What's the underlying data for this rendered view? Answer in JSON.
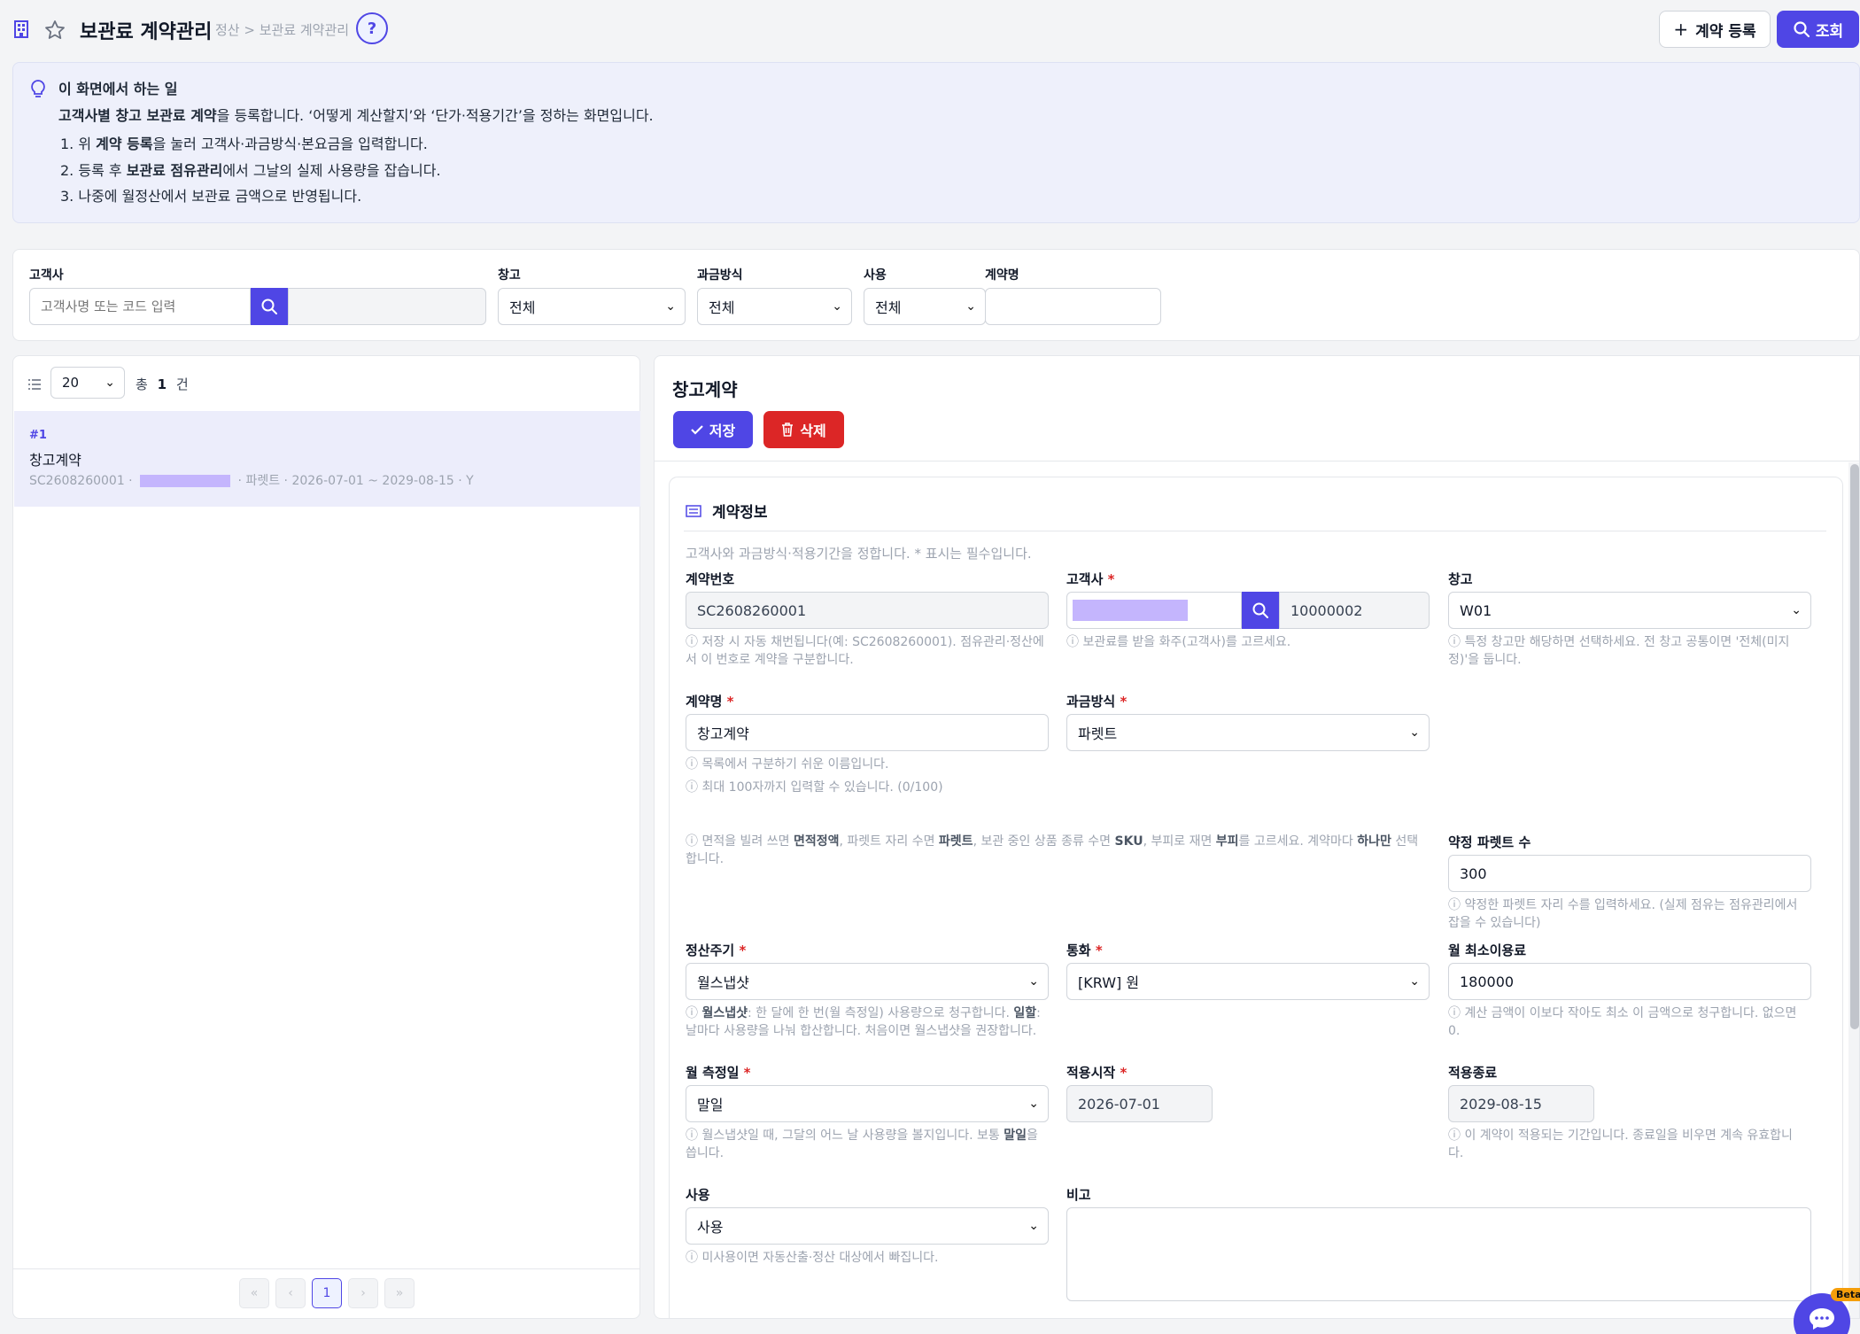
{
  "header": {
    "title": "보관료 계약관리",
    "breadcrumb": "정산 > 보관료 계약관리",
    "help_label": "?",
    "register_label": "계약 등록",
    "search_label": "조회"
  },
  "info": {
    "heading": "이 화면에서 하는 일",
    "intro_bold": "고객사별 창고 보관료 계약",
    "intro_rest": "을 등록합니다. ‘어떻게 계산할지’와 ‘단가·적용기간’을 정하는 화면입니다.",
    "step1_a": "1. 위 ",
    "step1_b": "계약 등록",
    "step1_c": "을 눌러 고객사·과금방식·본요금을 입력합니다.",
    "step2_a": "2. 등록 후 ",
    "step2_b": "보관료 점유관리",
    "step2_c": "에서 그날의 실제 사용량을 잡습니다.",
    "step3": "3. 나중에 월정산에서 보관료 금액으로 반영됩니다."
  },
  "filter": {
    "customer_label": "고객사",
    "customer_placeholder": "고객사명 또는 코드 입력",
    "warehouse_label": "창고",
    "warehouse_value": "전체",
    "billing_label": "과금방식",
    "billing_value": "전체",
    "use_label": "사용",
    "use_value": "전체",
    "contract_name_label": "계약명"
  },
  "list": {
    "page_size": "20",
    "total_prefix": "총",
    "total_count": "1",
    "total_suffix": "건",
    "items": [
      {
        "index": "#1",
        "name": "창고계약",
        "code": "SC2608260001 ·",
        "detail": "· 파렛트 · 2026-07-01 ~ 2029-08-15 · Y"
      }
    ],
    "pagination": {
      "first": "«",
      "prev": "‹",
      "current": "1",
      "next": "›",
      "last": "»"
    }
  },
  "detail": {
    "title": "창고계약",
    "save_label": "저장",
    "delete_label": "삭제",
    "section_title": "계약정보",
    "section_desc": "고객사와 과금방식·적용기간을 정합니다. * 표시는 필수입니다.",
    "contract_no_label": "계약번호",
    "contract_no_value": "SC2608260001",
    "contract_no_hint1": "ⓘ 저장 시 자동 채번됩니다(예: SC2608260001). 점유관리·정산에",
    "contract_no_hint2": "서 이 번호로 계약을 구분합니다.",
    "customer_label": "고객사",
    "customer_code": "10000002",
    "customer_hint": "ⓘ 보관료를 받을 화주(고객사)를 고르세요.",
    "warehouse_label": "창고",
    "warehouse_value": "W01",
    "warehouse_hint1": "ⓘ 특정 창고만 해당하면 선택하세요. 전 창고 공통이면 '전체(미지",
    "warehouse_hint2": "정)'을 둡니다.",
    "name_label": "계약명",
    "name_value": "창고계약",
    "name_hint1": "ⓘ 목록에서 구분하기 쉬운 이름입니다.",
    "name_hint2": "ⓘ 최대 100자까지 입력할 수 있습니다. (0/100)",
    "billing_label": "과금방식",
    "billing_value": "파렛트",
    "billing_hint_a": "ⓘ 면적을 빌려 쓰면 ",
    "billing_hint_b": "면적정액",
    "billing_hint_c": ", 파렛트 자리 수면 ",
    "billing_hint_d": "파렛트",
    "billing_hint_e": ", 보관 중인 상품 종류 수면 ",
    "billing_hint_f": "SKU",
    "billing_hint_g": ", 부피로 재면 ",
    "billing_hint_h": "부피",
    "billing_hint_i": "를 고르세요. 계약마다 ",
    "billing_hint_j": "하나만",
    "billing_hint_k": " 선택",
    "billing_hint_l": "합니다.",
    "pallet_label": "약정 파렛트 수",
    "pallet_value": "300",
    "pallet_hint1": "ⓘ 약정한 파렛트 자리 수를 입력하세요. (실제 점유는 점유관리에서",
    "pallet_hint2": "잡을 수 있습니다)",
    "cycle_label": "정산주기",
    "cycle_value": "월스냅샷",
    "cycle_hint_a": "ⓘ ",
    "cycle_hint_b": "월스냅샷",
    "cycle_hint_c": ": 한 달에 한 번(월 측정일) 사용량으로 청구합니다. ",
    "cycle_hint_d": "일할",
    "cycle_hint_e": ":",
    "cycle_hint2": "날마다 사용량을 나눠 합산합니다. 처음이면 월스냅샷을 권장합니다.",
    "currency_label": "통화",
    "currency_value": "[KRW] 원",
    "minfee_label": "월 최소이용료",
    "minfee_value": "180000",
    "minfee_hint1": "ⓘ 계산 금액이 이보다 작아도 최소 이 금액으로 청구합니다. 없으면",
    "minfee_hint2": "0.",
    "measure_label": "월 측정일",
    "measure_value": "말일",
    "measure_hint_a": "ⓘ 월스냅샷일 때, 그달의 어느 날 사용량을 볼지입니다. 보통 ",
    "measure_hint_b": "말일",
    "measure_hint_c": "을",
    "measure_hint2": "씁니다.",
    "start_label": "적용시작",
    "start_value": "2026-07-01",
    "end_label": "적용종료",
    "end_value": "2029-08-15",
    "period_hint1": "ⓘ 이 계약이 적용되는 기간입니다. 종료일을 비우면 계속 유효합니",
    "period_hint2": "다.",
    "use_label": "사용",
    "use_value": "사용",
    "use_hint": "ⓘ 미사용이면 자동산출·정산 대상에서 빠집니다.",
    "memo_label": "비고",
    "required_mark": "*"
  },
  "chat": {
    "badge": "Beta"
  },
  "colors": {
    "accent": "#4f46e5",
    "danger": "#dc2626",
    "mask": "#c4b5fd",
    "info_bg": "#eef0fb"
  }
}
